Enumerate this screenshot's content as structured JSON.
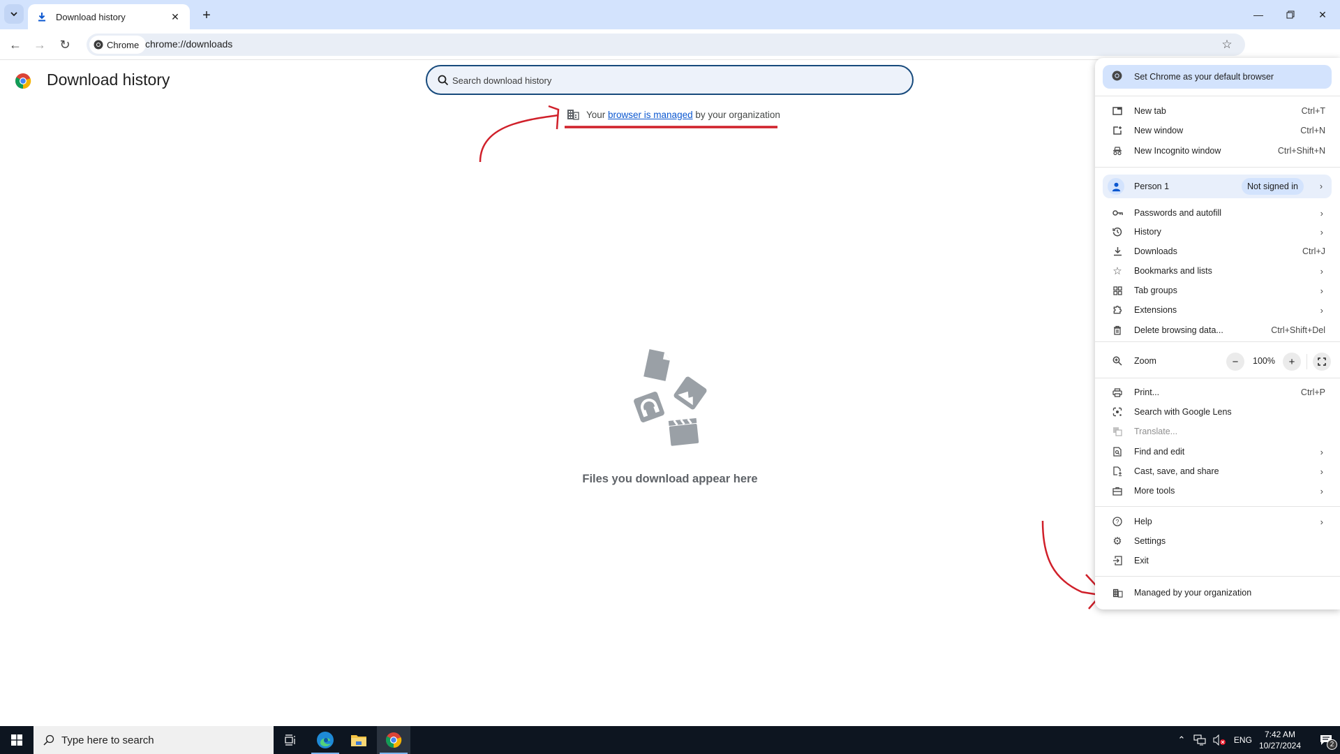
{
  "tabstrip": {
    "tab_title": "Download history",
    "tab_icon": "download-icon",
    "close_icon": "close-icon",
    "new_tab_icon": "plus-icon",
    "window_controls": [
      "minimize",
      "restore",
      "close"
    ]
  },
  "toolbar": {
    "site_chip_label": "Chrome",
    "url": "chrome://downloads"
  },
  "page": {
    "title": "Download history",
    "search_placeholder": "Search download history",
    "managed_prefix": "Your ",
    "managed_link": "browser is managed",
    "managed_suffix": " by your organization",
    "empty_text": "Files you download appear here"
  },
  "menu": {
    "default_browser": "Set Chrome as your default browser",
    "section1": [
      {
        "label": "New tab",
        "shortcut": "Ctrl+T",
        "icon": "new-tab-icon"
      },
      {
        "label": "New window",
        "shortcut": "Ctrl+N",
        "icon": "new-window-icon"
      },
      {
        "label": "New Incognito window",
        "shortcut": "Ctrl+Shift+N",
        "icon": "incognito-icon"
      }
    ],
    "profile": {
      "name": "Person 1",
      "status": "Not signed in"
    },
    "section2": [
      {
        "label": "Passwords and autofill",
        "submenu": true,
        "icon": "key-icon"
      },
      {
        "label": "History",
        "submenu": true,
        "icon": "history-icon"
      },
      {
        "label": "Downloads",
        "shortcut": "Ctrl+J",
        "icon": "download-icon"
      },
      {
        "label": "Bookmarks and lists",
        "submenu": true,
        "icon": "star-icon"
      },
      {
        "label": "Tab groups",
        "submenu": true,
        "icon": "tab-groups-icon"
      },
      {
        "label": "Extensions",
        "submenu": true,
        "icon": "puzzle-icon"
      },
      {
        "label": "Delete browsing data...",
        "shortcut": "Ctrl+Shift+Del",
        "icon": "trash-icon"
      }
    ],
    "zoom": {
      "label": "Zoom",
      "value": "100%",
      "minus": "−",
      "plus": "+"
    },
    "section3": [
      {
        "label": "Print...",
        "shortcut": "Ctrl+P",
        "icon": "print-icon"
      },
      {
        "label": "Search with Google Lens",
        "icon": "lens-icon"
      },
      {
        "label": "Translate...",
        "icon": "translate-icon",
        "disabled": true
      },
      {
        "label": "Find and edit",
        "submenu": true,
        "icon": "find-icon"
      },
      {
        "label": "Cast, save, and share",
        "submenu": true,
        "icon": "cast-icon"
      },
      {
        "label": "More tools",
        "submenu": true,
        "icon": "toolbox-icon"
      }
    ],
    "section4": [
      {
        "label": "Help",
        "submenu": true,
        "icon": "help-icon"
      },
      {
        "label": "Settings",
        "icon": "gear-icon"
      },
      {
        "label": "Exit",
        "icon": "exit-icon"
      }
    ],
    "managed": "Managed by your organization"
  },
  "taskbar": {
    "search_placeholder": "Type here to search",
    "language": "ENG",
    "time": "7:42 AM",
    "date": "10/27/2024",
    "notification_count": "2"
  },
  "colors": {
    "accent": "#0b57d0",
    "tabstrip_bg": "#d3e3fd",
    "annotation_red": "#d0202a",
    "search_border": "#174a7c"
  }
}
